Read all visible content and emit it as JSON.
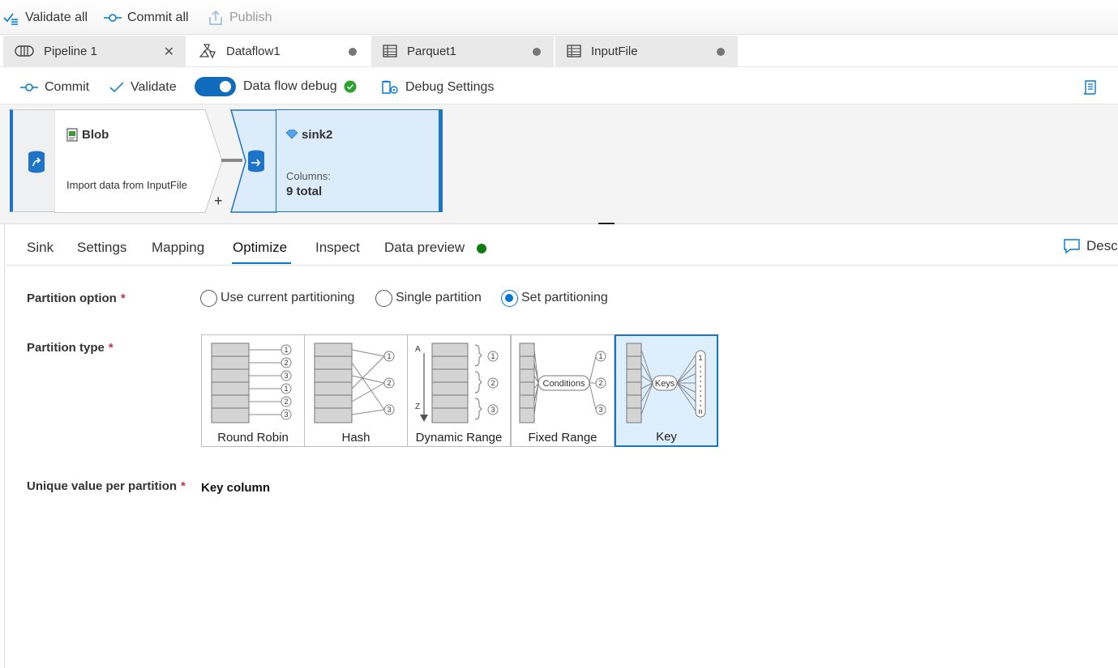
{
  "topbar": {
    "validate_all": "Validate all",
    "commit_all": "Commit all",
    "publish": "Publish"
  },
  "tabs": [
    {
      "label": "Pipeline 1",
      "icon": "pipeline-icon",
      "tail": "close"
    },
    {
      "label": "Dataflow1",
      "icon": "dataflow-icon",
      "tail": "dot"
    },
    {
      "label": "Parquet1",
      "icon": "table-icon",
      "tail": "dot"
    },
    {
      "label": "InputFile",
      "icon": "table-icon",
      "tail": "dot"
    }
  ],
  "toolbar": {
    "commit": "Commit",
    "validate": "Validate",
    "debug_label": "Data flow debug",
    "debug_on": true,
    "debug_settings": "Debug Settings"
  },
  "canvas": {
    "source": {
      "title": "Blob",
      "description": "Import data from InputFile",
      "add_symbol": "+"
    },
    "sink": {
      "title": "sink2",
      "columns_label": "Columns:",
      "columns_value": "9 total"
    }
  },
  "detail_tabs": [
    "Sink",
    "Settings",
    "Mapping",
    "Optimize",
    "Inspect",
    "Data preview"
  ],
  "active_detail_tab": "Optimize",
  "description_link": "Desc",
  "optimize": {
    "partition_option_label": "Partition option",
    "required_mark": "*",
    "partition_options": [
      "Use current partitioning",
      "Single partition",
      "Set partitioning"
    ],
    "selected_option": "Set partitioning",
    "partition_type_label": "Partition type",
    "partition_types": [
      "Round Robin",
      "Hash",
      "Dynamic Range",
      "Fixed Range",
      "Key"
    ],
    "selected_type": "Key",
    "diagram_text": {
      "conditions": "Conditions",
      "keys": "Keys",
      "range_start": "A",
      "range_end": "Z",
      "n": "n",
      "one": "1",
      "two": "2",
      "three": "3"
    },
    "unique_label": "Unique value per partition",
    "unique_value": "Key column"
  },
  "colors": {
    "accent": "#0078d4",
    "status_green": "#2aa12a",
    "data_preview_dot": "#107c10",
    "sink_fill": "#dcecfb",
    "node_bar": "#1e74c7"
  }
}
